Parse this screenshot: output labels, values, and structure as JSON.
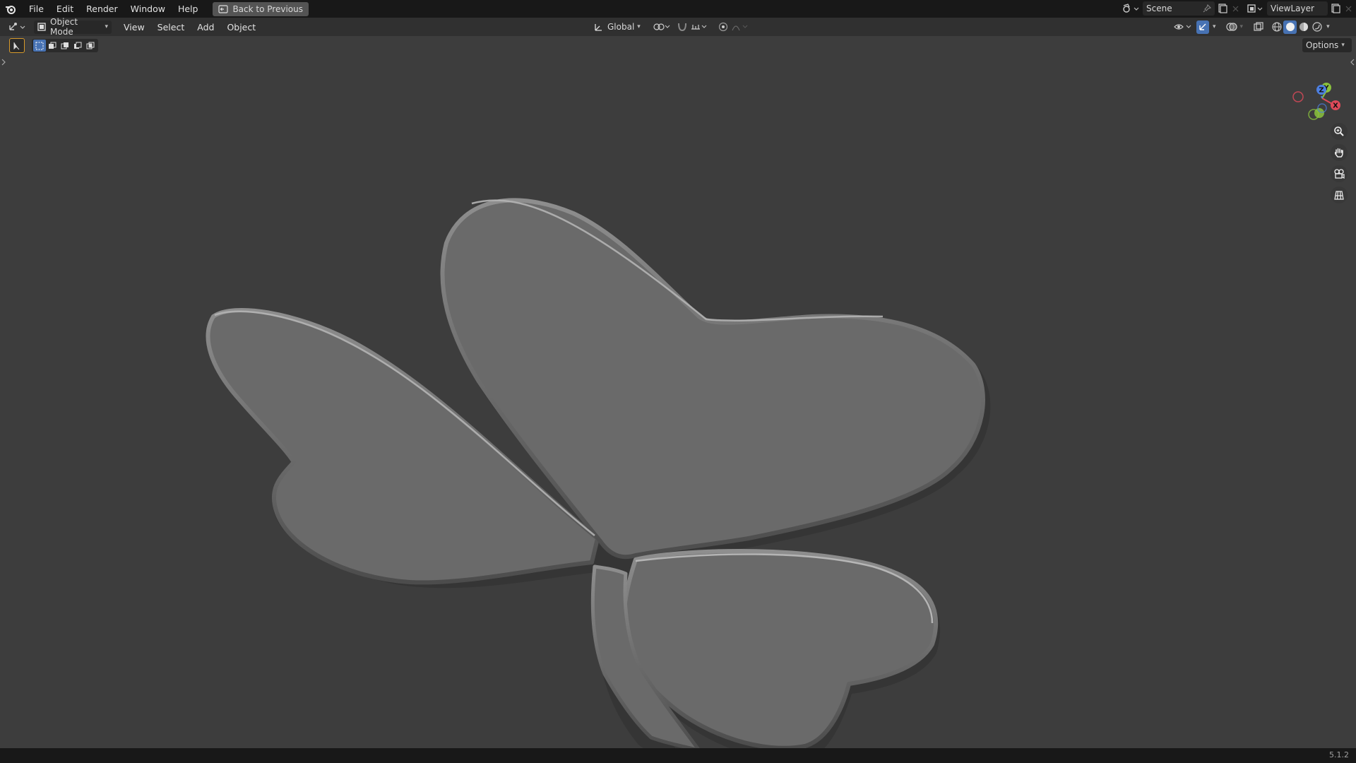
{
  "topbar": {
    "menus": [
      "File",
      "Edit",
      "Render",
      "Window",
      "Help"
    ],
    "back_button": "Back to Previous",
    "scene_label": "Scene",
    "viewlayer_label": "ViewLayer"
  },
  "header": {
    "mode_label": "Object Mode",
    "menus": [
      "View",
      "Select",
      "Add",
      "Object"
    ],
    "orientation_label": "Global",
    "options_label": "Options"
  },
  "viewport": {
    "gizmo_axes": {
      "z": "Z",
      "y": "Y",
      "x": "X"
    },
    "object_color": "#6a6a6a"
  },
  "status": {
    "version": "5.1.2"
  },
  "colors": {
    "accent": "#4772b3",
    "axis_x": "#e04a5a",
    "axis_y": "#8bc33d",
    "axis_z": "#4d7fe0",
    "background": "#3d3d3d"
  }
}
